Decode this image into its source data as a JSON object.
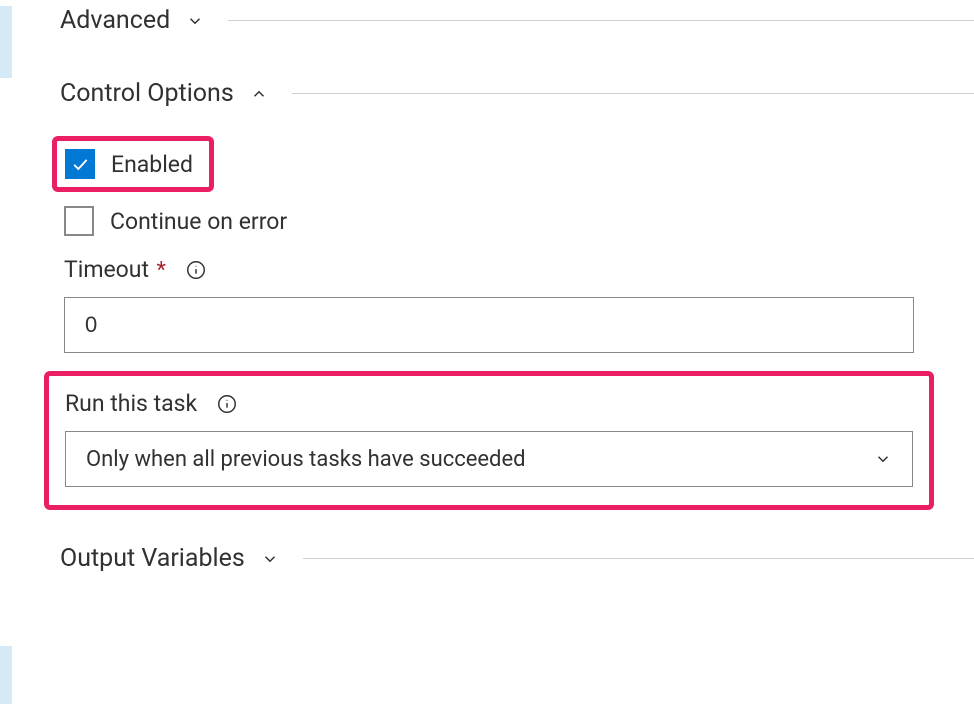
{
  "sections": {
    "advanced": {
      "title": "Advanced",
      "expanded": false
    },
    "control_options": {
      "title": "Control Options",
      "expanded": true,
      "enabled": {
        "label": "Enabled",
        "checked": true
      },
      "continue_on_error": {
        "label": "Continue on error",
        "checked": false
      },
      "timeout": {
        "label": "Timeout",
        "required": true,
        "value": "0"
      },
      "run_this_task": {
        "label": "Run this task",
        "selected": "Only when all previous tasks have succeeded"
      }
    },
    "output_variables": {
      "title": "Output Variables",
      "expanded": false
    }
  },
  "colors": {
    "highlight": "#e91e63",
    "checkbox_checked": "#0078d4"
  }
}
